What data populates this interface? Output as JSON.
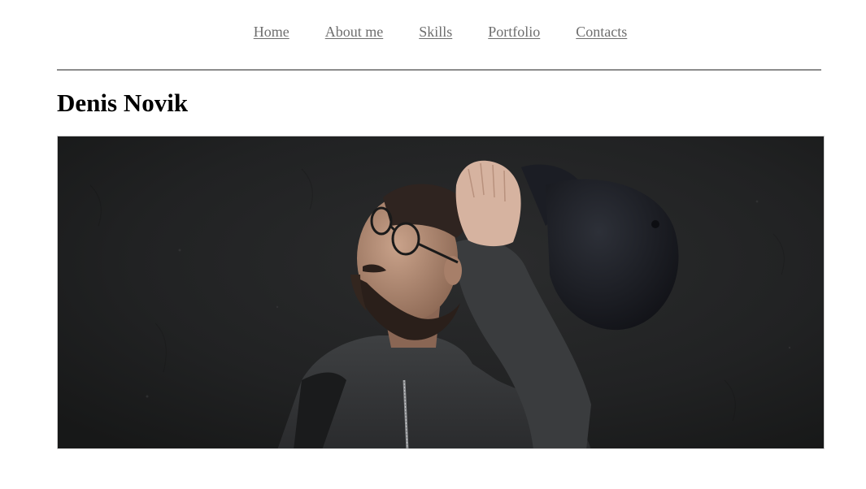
{
  "nav": {
    "items": [
      {
        "label": "Home"
      },
      {
        "label": "About me"
      },
      {
        "label": "Skills"
      },
      {
        "label": "Portfolio"
      },
      {
        "label": "Contacts"
      }
    ]
  },
  "header": {
    "title": "Denis Novik"
  },
  "hero": {
    "subject": "portrait photo"
  },
  "colors": {
    "nav_link": "#6e6e6e",
    "divider": "#8c8c8c",
    "title": "#000000",
    "photo_background": "#1f2021"
  }
}
